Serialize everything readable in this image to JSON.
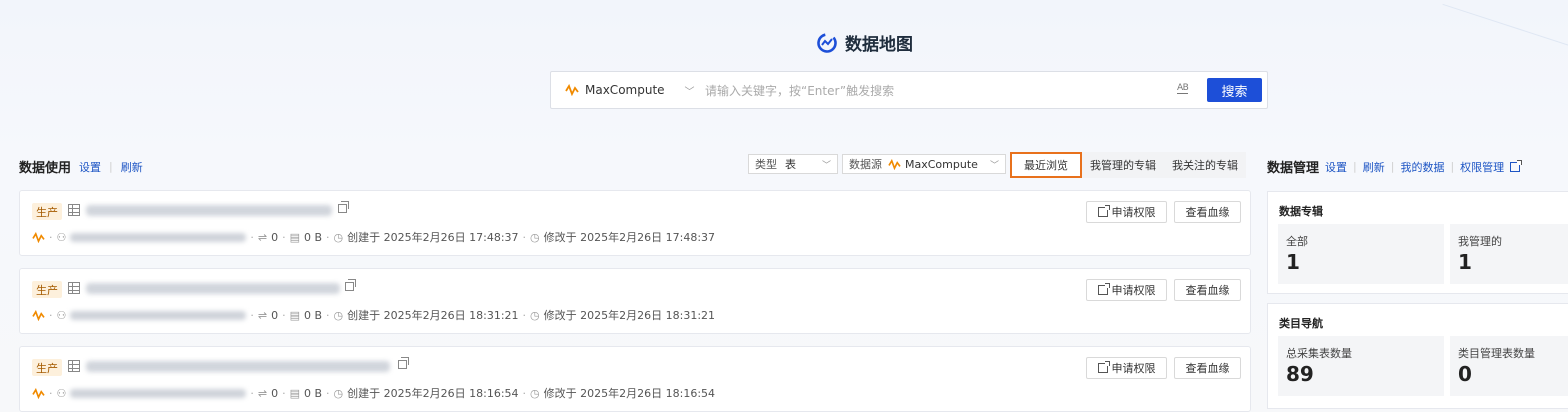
{
  "brand": {
    "title": "数据地图",
    "accent": "#1d4fd8"
  },
  "search": {
    "source": "MaxCompute",
    "placeholder": "请输入关键字，按“Enter”触发搜索",
    "ab_label": "AB",
    "button": "搜索"
  },
  "usage": {
    "title": "数据使用",
    "links": [
      "设置",
      "刷新"
    ],
    "filter_type_key": "类型",
    "filter_type_value": "表",
    "filter_source_key": "数据源",
    "filter_source_value": "MaxCompute",
    "tabs": [
      "最近浏览",
      "我管理的专辑",
      "我关注的专辑"
    ],
    "active_tab": "最近浏览"
  },
  "records": [
    {
      "tag": "生产",
      "partitions": "0",
      "size": "0 B",
      "created": "创建于 2025年2月26日 17:48:37",
      "modified": "修改于 2025年2月26日 17:48:37",
      "btn_apply": "申请权限",
      "btn_lineage": "查看血缘"
    },
    {
      "tag": "生产",
      "partitions": "0",
      "size": "0 B",
      "created": "创建于 2025年2月26日 18:31:21",
      "modified": "修改于 2025年2月26日 18:31:21",
      "btn_apply": "申请权限",
      "btn_lineage": "查看血缘"
    },
    {
      "tag": "生产",
      "partitions": "0",
      "size": "0 B",
      "created": "创建于 2025年2月26日 18:16:54",
      "modified": "修改于 2025年2月26日 18:16:54",
      "btn_apply": "申请权限",
      "btn_lineage": "查看血缘"
    }
  ],
  "management": {
    "title": "数据管理",
    "links": [
      "设置",
      "刷新",
      "我的数据",
      "权限管理"
    ],
    "albums": {
      "title": "数据专辑",
      "stats": [
        {
          "label": "全部",
          "value": "1"
        },
        {
          "label": "我管理的",
          "value": "1"
        }
      ]
    },
    "categories": {
      "title": "类目导航",
      "stats": [
        {
          "label": "总采集表数量",
          "value": "89"
        },
        {
          "label": "类目管理表数量",
          "value": "0"
        }
      ]
    }
  }
}
